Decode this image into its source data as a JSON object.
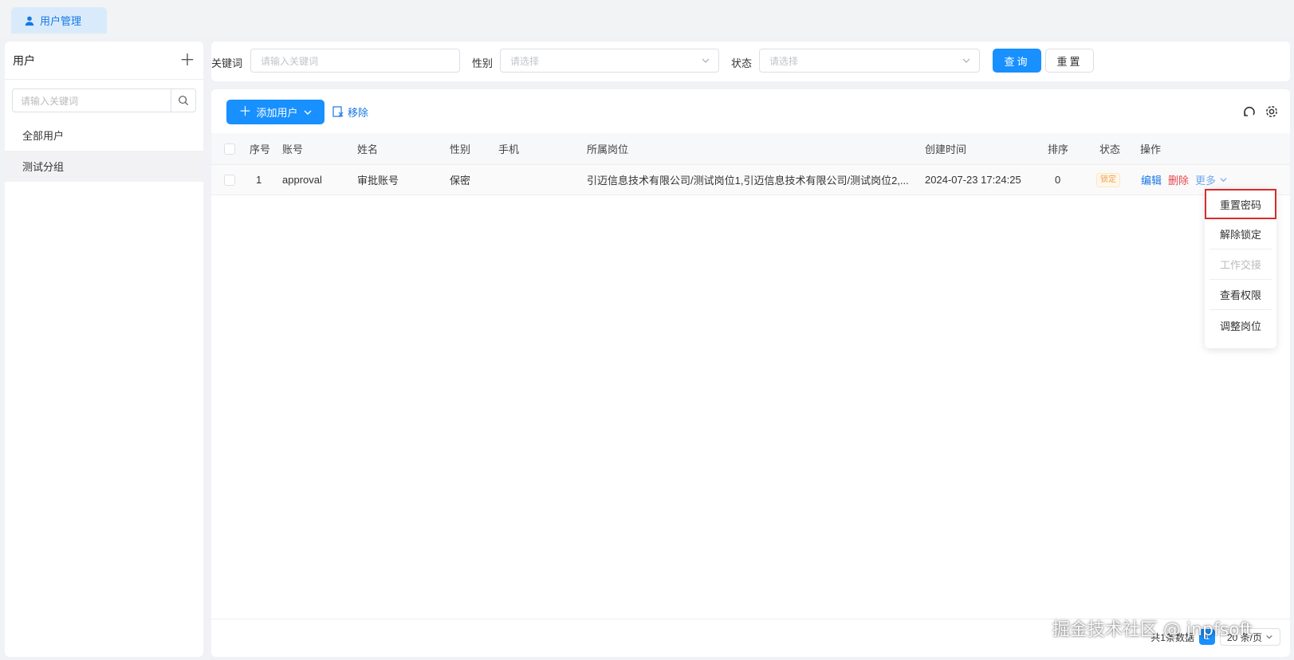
{
  "tabs": [
    {
      "label": "用户管理",
      "icon": "user-icon"
    }
  ],
  "sidebar": {
    "title": "用户",
    "add_icon": "plus-icon",
    "search_placeholder": "请输入关键词",
    "items": [
      {
        "label": "全部用户"
      },
      {
        "label": "测试分组"
      }
    ]
  },
  "filters": {
    "keyword_label": "关键词",
    "keyword_placeholder": "请输入关键词",
    "gender_label": "性别",
    "gender_placeholder": "请选择",
    "status_label": "状态",
    "status_placeholder": "请选择",
    "search_button": "查询",
    "reset_button": "重置"
  },
  "toolbar": {
    "add_user": "添加用户",
    "remove": "移除"
  },
  "table": {
    "columns": [
      "序号",
      "账号",
      "姓名",
      "性别",
      "手机",
      "所属岗位",
      "创建时间",
      "排序",
      "状态",
      "操作"
    ],
    "rows": [
      {
        "index": "1",
        "account": "approval",
        "name": "审批账号",
        "gender": "保密",
        "phone": "",
        "position": "引迈信息技术有限公司/测试岗位1,引迈信息技术有限公司/测试岗位2,...",
        "created": "2024-07-23 17:24:25",
        "sort": "0",
        "status": "锁定",
        "edit": "编辑",
        "delete": "删除",
        "more": "更多"
      }
    ]
  },
  "more_menu": [
    {
      "label": "重置密码"
    },
    {
      "label": "解除锁定"
    },
    {
      "label": "工作交接"
    },
    {
      "label": "查看权限"
    },
    {
      "label": "调整岗位"
    }
  ],
  "pager": {
    "total_text": "共1条数据",
    "current_page": "1",
    "page_size": "20 条/页"
  },
  "watermark": "掘金技术社区 @ jnpfsoft",
  "colors": {
    "primary": "#1890ff",
    "danger": "#e8464d",
    "highlight_border": "#d92b2b"
  }
}
